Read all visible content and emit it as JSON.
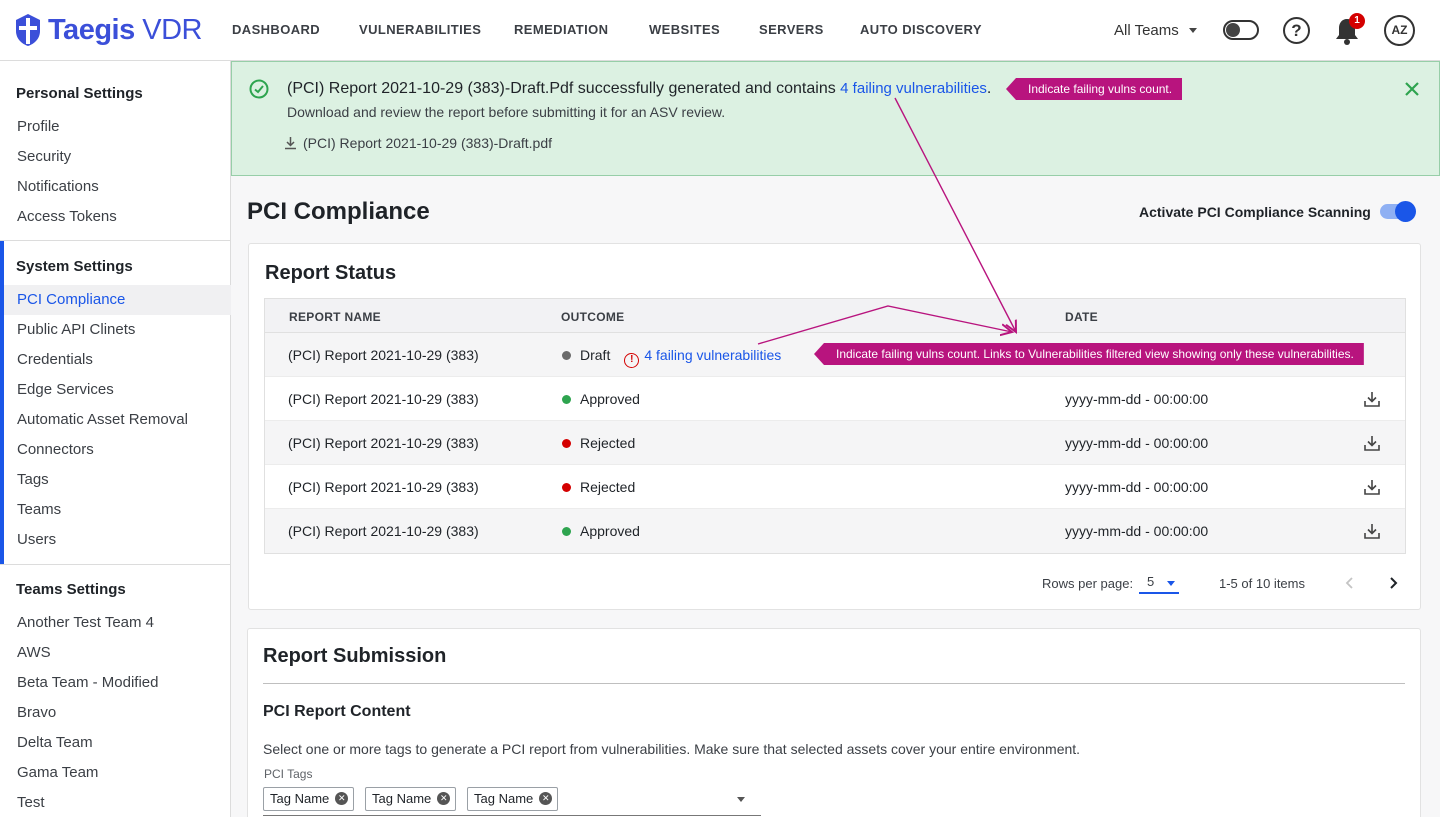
{
  "brand": {
    "name_bold": "Taegis",
    "name_light": " VDR"
  },
  "nav": {
    "items": [
      "DASHBOARD",
      "VULNERABILITIES",
      "REMEDIATION",
      "WEBSITES",
      "SERVERS",
      "AUTO DISCOVERY"
    ],
    "team_select": "All Teams",
    "help_glyph": "?",
    "notification_count": "1",
    "avatar_initials": "AZ"
  },
  "sidebar": {
    "personal": {
      "title": "Personal Settings",
      "items": [
        "Profile",
        "Security",
        "Notifications",
        "Access Tokens"
      ]
    },
    "system": {
      "title": "System Settings",
      "items": [
        "PCI Compliance",
        "Public API Clinets",
        "Credentials",
        "Edge Services",
        "Automatic Asset Removal",
        "Connectors",
        "Tags",
        "Teams",
        "Users"
      ],
      "selected": "PCI Compliance"
    },
    "teams": {
      "title": "Teams Settings",
      "items": [
        "Another Test Team 4",
        "AWS",
        "Beta Team - Modified",
        "Bravo",
        "Delta Team",
        "Gama Team",
        "Test"
      ]
    }
  },
  "banner": {
    "message_prefix": "(PCI) Report 2021-10-29 (383)-Draft.Pdf successfully generated and contains ",
    "failing_link": "4 failing vulnerabilities",
    "message_suffix": ".",
    "subtext": "Download and review the report before submitting it for an ASV review.",
    "file_name": "(PCI) Report 2021-10-29 (383)-Draft.pdf"
  },
  "annotations": {
    "banner_note": "Indicate failing vulns count.",
    "table_note": "Indicate failing vulns count. Links to Vulnerabilities filtered view showing only these vulnerabilities."
  },
  "page": {
    "title": "PCI Compliance",
    "scan_toggle_label": "Activate PCI Compliance Scanning",
    "scan_enabled": true
  },
  "report_status": {
    "title": "Report Status",
    "columns": [
      "REPORT NAME",
      "OUTCOME",
      "DATE"
    ],
    "rows": [
      {
        "name": "(PCI) Report 2021-10-29 (383)",
        "outcome": "Draft",
        "status_color": "#6b6b6b",
        "failing": "4 failing vulnerabilities",
        "date": "",
        "download": false
      },
      {
        "name": "(PCI) Report 2021-10-29 (383)",
        "outcome": "Approved",
        "status_color": "#2ea44f",
        "failing": "",
        "date": "yyyy-mm-dd - 00:00:00",
        "download": true
      },
      {
        "name": "(PCI) Report 2021-10-29 (383)",
        "outcome": "Rejected",
        "status_color": "#d40000",
        "failing": "",
        "date": "yyyy-mm-dd - 00:00:00",
        "download": true
      },
      {
        "name": "(PCI) Report 2021-10-29 (383)",
        "outcome": "Rejected",
        "status_color": "#d40000",
        "failing": "",
        "date": "yyyy-mm-dd - 00:00:00",
        "download": true
      },
      {
        "name": "(PCI) Report 2021-10-29 (383)",
        "outcome": "Approved",
        "status_color": "#2ea44f",
        "failing": "",
        "date": "yyyy-mm-dd - 00:00:00",
        "download": true
      }
    ],
    "pager": {
      "rows_label": "Rows per page:",
      "rows_value": "5",
      "range": "1-5 of 10 items"
    }
  },
  "report_submission": {
    "title": "Report Submission",
    "content_heading": "PCI Report Content",
    "description": "Select one or more tags to generate a PCI report from vulnerabilities. Make sure that selected assets cover your entire environment.",
    "tags_label": "PCI Tags",
    "tags": [
      "Tag Name",
      "Tag Name",
      "Tag Name"
    ]
  },
  "colors": {
    "accent": "#1a56e8",
    "annotation": "#b8147e",
    "success_bg": "#dcf1e2",
    "error": "#d40000"
  }
}
